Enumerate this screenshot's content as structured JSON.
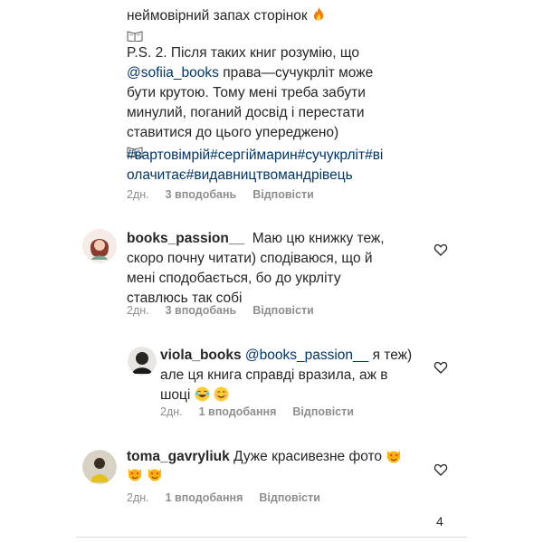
{
  "comment1": {
    "line1": "неймовірний запах сторінок",
    "ps_prefix": "P.S. 2. Після таких книг розумію, що",
    "mention": "@sofiia_books",
    "ps_rest1": " права—сучукрліт може",
    "ps_line3": "бути крутою. Тому мені треба забути",
    "ps_line4": "минулий, поганий досвід і перестати",
    "ps_line5": "ставитися до цього упереджено)",
    "hashtags_line1": "#вартовімрій#сергіймарин#сучукрліт#ві",
    "hashtags_line2": "олачитає#видавництвомандрівець",
    "meta": {
      "time": "2дн.",
      "likes": "3 вподобань",
      "reply": "Відповісти"
    }
  },
  "comment2": {
    "username": "books_passion__",
    "line1": "Маю цю книжку теж,",
    "line2": "скоро почну читати) сподіваюся, що й",
    "line3": "мені сподобається, бо до укрліту",
    "line4": "ставлюсь так собі",
    "meta": {
      "time": "2дн.",
      "likes": "3 вподобань",
      "reply": "Відповісти"
    }
  },
  "comment3": {
    "username": "viola_books",
    "mention": "@books_passion__",
    "line1_rest": " я теж)",
    "line2": "але ця книга справді вразила, аж в",
    "line3": "шоці",
    "meta": {
      "time": "2дн.",
      "likes": "1 вподобання",
      "reply": "Відповісти"
    }
  },
  "comment4": {
    "username": "toma_gavryliuk",
    "text": "Дуже красивезне фото",
    "meta": {
      "time": "2дн.",
      "likes": "1 вподобання",
      "reply": "Відповісти"
    }
  },
  "page_number": "4",
  "colors": {
    "hashtag": "#003569",
    "meta": "#8e8e8e",
    "text": "#262626"
  },
  "icons": [
    "fire-icon",
    "open-book-icon",
    "heart-icon",
    "laughing-tears-icon",
    "smiling-icon",
    "heart-eyes-cat-icon"
  ]
}
